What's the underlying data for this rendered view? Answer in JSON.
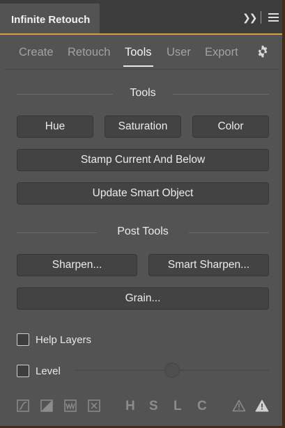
{
  "panel": {
    "title": "Infinite Retouch"
  },
  "tabs": [
    {
      "label": "Create",
      "active": false
    },
    {
      "label": "Retouch",
      "active": false
    },
    {
      "label": "Tools",
      "active": true
    },
    {
      "label": "User",
      "active": false
    },
    {
      "label": "Export",
      "active": false
    }
  ],
  "sections": {
    "tools_heading": "Tools",
    "post_heading": "Post Tools"
  },
  "buttons": {
    "hue": "Hue",
    "saturation": "Saturation",
    "color": "Color",
    "stamp": "Stamp Current And Below",
    "update_smart": "Update Smart Object",
    "sharpen": "Sharpen...",
    "smart_sharpen": "Smart Sharpen...",
    "grain": "Grain..."
  },
  "options": {
    "help_layers": {
      "label": "Help Layers",
      "checked": false
    },
    "level": {
      "label": "Level",
      "checked": false,
      "value": 0.5
    }
  },
  "bottom_letters": [
    "H",
    "S",
    "L",
    "C"
  ],
  "icons": [
    "curves-icon",
    "contrast-icon",
    "waveform-icon",
    "clipping-icon",
    "warning-outline-icon",
    "warning-filled-icon"
  ],
  "colors": {
    "panel_bg": "#535353",
    "button_bg": "#434343",
    "accent": "#d4a23a"
  }
}
